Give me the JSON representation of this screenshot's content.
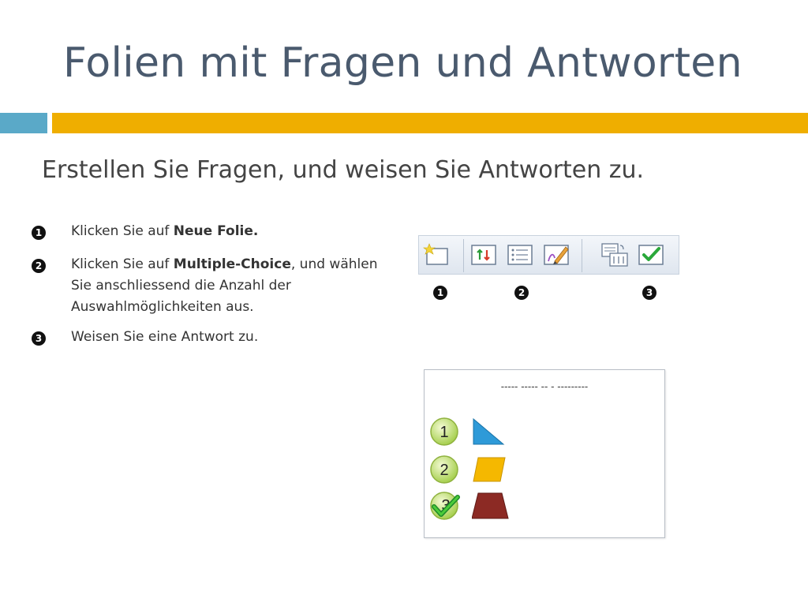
{
  "slide": {
    "title": "Folien mit Fragen und Antworten",
    "subtitle": "Erstellen Sie Fragen, und weisen Sie Antworten zu."
  },
  "steps": [
    {
      "num": "1",
      "pre": "Klicken Sie auf ",
      "bold": "Neue Folie.",
      "post": ""
    },
    {
      "num": "2",
      "pre": "Klicken Sie auf ",
      "bold": "Multiple-Choice",
      "post": ", und wählen Sie anschliessend die Anzahl der Auswahlmöglichkeiten aus."
    },
    {
      "num": "3",
      "pre": "Weisen Sie eine Antwort zu.",
      "bold": "",
      "post": ""
    }
  ],
  "toolbar": {
    "buttons": [
      "new-slide-icon",
      "multiple-choice-icon",
      "list-icon",
      "draw-icon",
      "answer-options-icon",
      "assign-answer-icon"
    ],
    "markers": [
      "1",
      "2",
      "3"
    ]
  },
  "preview": {
    "question": "----- ----- -- - ---------",
    "answers": [
      "1",
      "2",
      "3"
    ]
  },
  "colors": {
    "title": "#4a5a6e",
    "accent_blue": "#5aa9c8",
    "accent_gold": "#efae00"
  }
}
